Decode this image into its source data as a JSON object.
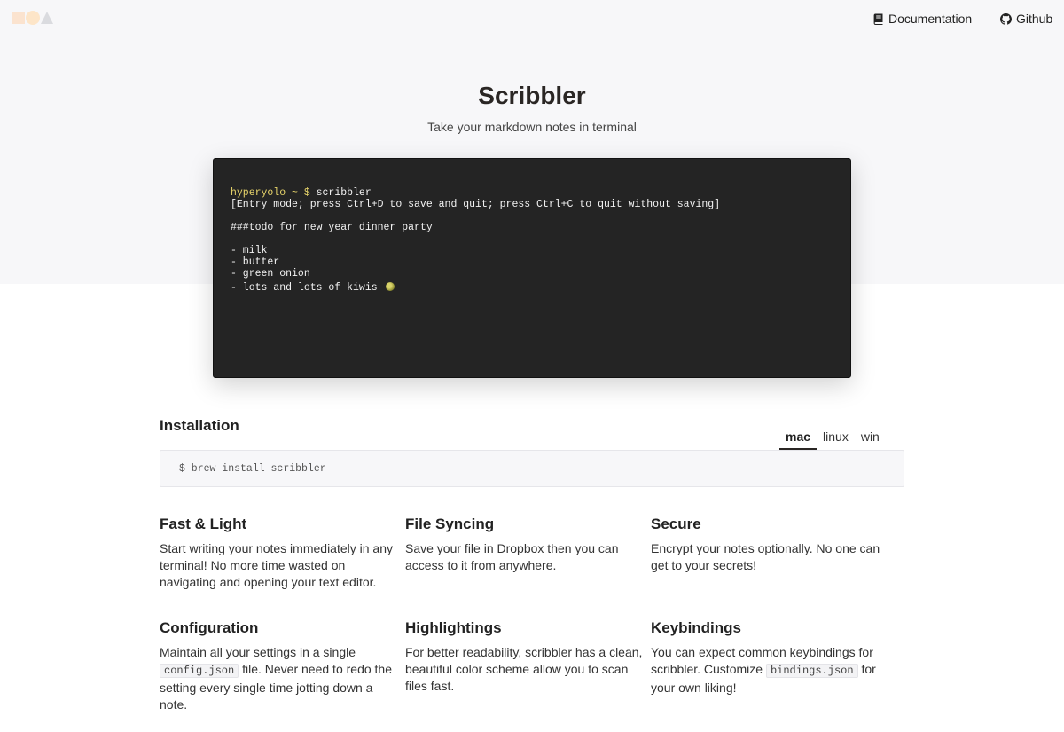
{
  "nav": {
    "documentation_label": "Documentation",
    "github_label": "Github"
  },
  "hero": {
    "title": "Scribbler",
    "subtitle": "Take your markdown notes in terminal"
  },
  "terminal": {
    "prompt": "hyperyolo ~ $",
    "command": " scribbler",
    "mode_line": "[Entry mode; press Ctrl+D to save and quit; press Ctrl+C to quit without saving]",
    "heading_line": "###todo for new year dinner party",
    "items": [
      "- milk",
      "- butter",
      "- green onion",
      "- lots and lots of kiwis"
    ],
    "kiwi_icon": "kiwi-icon"
  },
  "installation": {
    "heading": "Installation",
    "tabs": [
      {
        "label": "mac",
        "active": true
      },
      {
        "label": "linux",
        "active": false
      },
      {
        "label": "win",
        "active": false
      }
    ],
    "command": "$ brew install scribbler"
  },
  "features": [
    {
      "title": "Fast & Light",
      "text": "Start writing your notes immediately in any terminal! No more time wasted on navigating and opening your text editor."
    },
    {
      "title": "File Syncing",
      "text": "Save your file in Dropbox then you can access to it from anywhere."
    },
    {
      "title": "Secure",
      "text": "Encrypt your notes optionally. No one can get to your secrets!"
    },
    {
      "title": "Configuration",
      "text_before": "Maintain all your settings in a single ",
      "code": "config.json",
      "text_after": " file. Never need to redo the setting every single time jotting down a note."
    },
    {
      "title": "Highlightings",
      "text": "For better readability, scribbler has a clean, beautiful color scheme allow you to scan files fast."
    },
    {
      "title": "Keybindings",
      "text_before": "You can expect common keybindings for scribbler. Customize ",
      "code": "bindings.json",
      "text_after": " for your own liking!"
    }
  ],
  "colors": {
    "hero_background": "#f7f7f9",
    "terminal_background": "#242424",
    "prompt_color": "#e6d36a",
    "text_dark": "#2a2624"
  }
}
